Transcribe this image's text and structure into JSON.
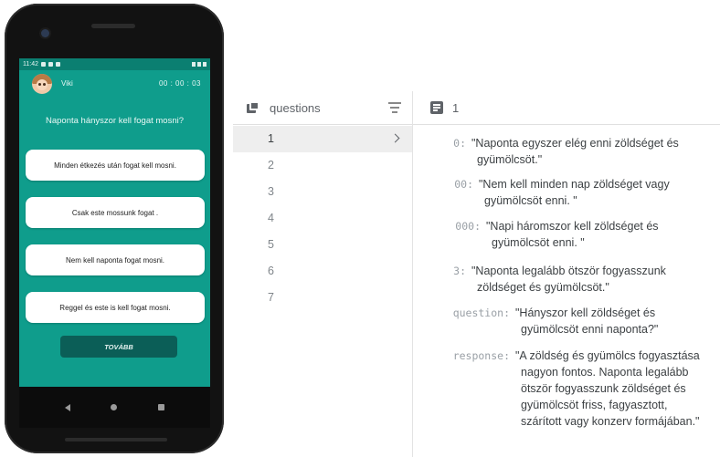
{
  "phone": {
    "status_time": "11:42",
    "user_name": "Viki",
    "timer": "00 : 00 : 03",
    "question": "Naponta hányszor kell fogat mosni?",
    "answers": [
      "Minden étkezés után fogat kell mosni.",
      "Csak este mossunk fogat .",
      "Nem kell naponta fogat mosni.",
      "Reggel és este is kell fogat mosni."
    ],
    "next_button": "TOVÁBB",
    "colors": {
      "screen": "#0f9d8c",
      "button": "#0b5e57"
    }
  },
  "firestore": {
    "collection": "questions",
    "document_id": "1",
    "documents": [
      "1",
      "2",
      "3",
      "4",
      "5",
      "6",
      "7"
    ],
    "fields": [
      {
        "key": "0:",
        "value_lines": [
          "\"Naponta egyszer elég enni zöldséget és",
          "gyümölcsöt.\""
        ]
      },
      {
        "key": "00:",
        "value_lines": [
          "\"Nem kell minden nap zöldséget vagy",
          "gyümölcsöt enni. \""
        ]
      },
      {
        "key": "000:",
        "value_lines": [
          "\"Napi háromszor kell zöldséget és",
          "gyümölcsöt enni. \""
        ]
      },
      {
        "key": "3:",
        "value_lines": [
          "\"Naponta legalább ötször fogyasszunk",
          "zöldséget és gyümölcsöt.\""
        ]
      },
      {
        "key": "question:",
        "value_lines": [
          "\"Hányszor kell zöldséget és",
          "gyümölcsöt enni naponta?\""
        ]
      },
      {
        "key": "response:",
        "value_lines": [
          "\"A zöldség és gyümölcs fogyasztása",
          "nagyon fontos. Naponta legalább",
          "ötször fogyasszunk zöldséget és",
          "gyümölcsöt friss, fagyasztott,",
          "szárított vagy konzerv formájában.\""
        ]
      }
    ]
  }
}
